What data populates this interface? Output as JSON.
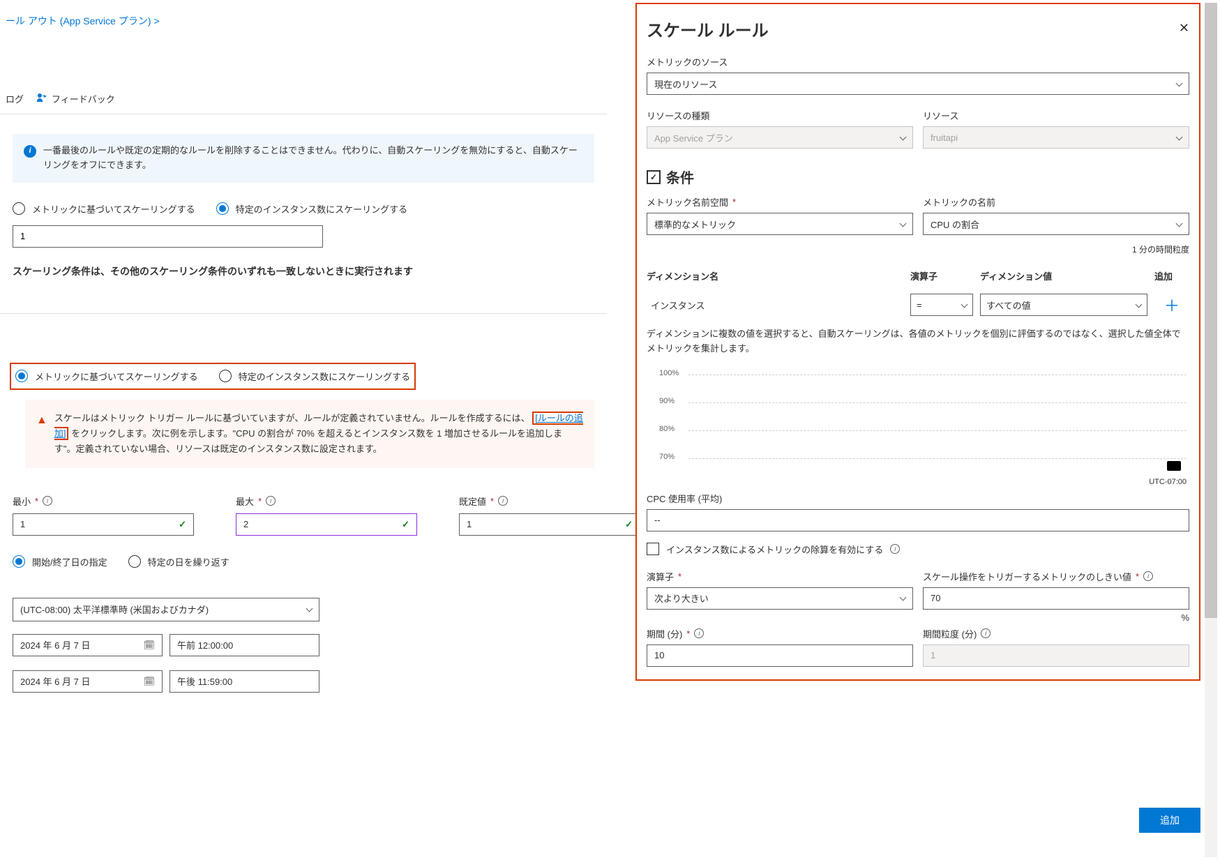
{
  "breadcrumb": "ール アウト (App Service プラン) >",
  "toolbar": {
    "log": "ログ",
    "feedback": "フィードバック"
  },
  "infoBox": "一番最後のルールや既定の定期的なルールを削除することはできません。代わりに、自動スケーリングを無効にすると、自動スケーリングをオフにできます。",
  "radios": {
    "metric": "メトリックに基づいてスケーリングする",
    "instance": "特定のインスタンス数にスケーリングする"
  },
  "instanceInput": "1",
  "noteText": "スケーリング条件は、その他のスケーリング条件のいずれも一致しないときに実行されます",
  "warn": {
    "part1": "スケールはメトリック トリガー ルールに基づいていますが、ルールが定義されていません。ルールを作成するには、",
    "link": "[ルールの追加]",
    "part2": " をクリックします。次に例を示します。\"CPU の割合が 70% を超えるとインスタンス数を 1 増加させるルールを追加します\"。定義されていない場合、リソースは既定のインスタンス数に設定されます。"
  },
  "limits": {
    "min": {
      "label": "最小",
      "value": "1"
    },
    "max": {
      "label": "最大",
      "value": "2"
    },
    "default": {
      "label": "既定値",
      "value": "1"
    }
  },
  "schedule": {
    "startEnd": "開始/終了日の指定",
    "repeat": "特定の日を繰り返す",
    "timezone": "(UTC-08:00) 太平洋標準時 (米国およびカナダ)",
    "date1": "2024 年 6 月 7 日",
    "time1": "午前 12:00:00",
    "date2": "2024 年 6 月 7 日",
    "time2": "午後 11:59:00"
  },
  "panel": {
    "title": "スケール ルール",
    "metricSource": {
      "label": "メトリックのソース",
      "value": "現在のリソース"
    },
    "resourceType": {
      "label": "リソースの種類",
      "value": "App Service プラン"
    },
    "resource": {
      "label": "リソース",
      "value": "fruitapi"
    },
    "conditions": "条件",
    "namespace": {
      "label": "メトリック名前空間",
      "value": "標準的なメトリック"
    },
    "metricName": {
      "label": "メトリックの名前",
      "value": "CPU の割合"
    },
    "granularity": "1 分の時間粒度",
    "dimTable": {
      "h1": "ディメンション名",
      "h2": "演算子",
      "h3": "ディメンション値",
      "h4": "追加",
      "name": "インスタンス",
      "op": "=",
      "val": "すべての値"
    },
    "dimHelp": "ディメンションに複数の値を選択すると、自動スケーリングは、各値のメトリックを個別に評価するのではなく、選択した値全体でメトリックを集計します。",
    "cpc": {
      "label": "CPC 使用率 (平均)",
      "value": "--"
    },
    "divideCheck": "インスタンス数によるメトリックの除算を有効にする",
    "operator": {
      "label": "演算子",
      "value": "次より大きい"
    },
    "threshold": {
      "label": "スケール操作をトリガーするメトリックのしきい値",
      "value": "70"
    },
    "duration": {
      "label": "期間 (分)",
      "value": "10"
    },
    "durGran": {
      "label": "期間粒度 (分)",
      "value": "1"
    },
    "addBtn": "追加",
    "pct": "%"
  },
  "chart_data": {
    "type": "line",
    "title": "",
    "xlabel": "",
    "ylabel": "",
    "ylim": [
      70,
      100
    ],
    "yticks": [
      70,
      80,
      90,
      100
    ],
    "timezone": "UTC-07:00",
    "series": [],
    "note": "empty chart with dashed horizontal gridlines at 70/80/90/100 and a single black marker near bottom-right"
  }
}
